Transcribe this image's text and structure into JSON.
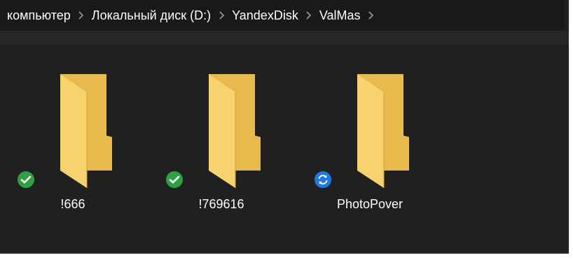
{
  "breadcrumb": {
    "items": [
      {
        "label": "компьютер"
      },
      {
        "label": "Локальный диск (D:)"
      },
      {
        "label": "YandexDisk"
      },
      {
        "label": "ValMas"
      }
    ]
  },
  "folders": [
    {
      "name": "!666",
      "status": "synced",
      "icon": "green-check-icon",
      "color": "#2ea043"
    },
    {
      "name": "!769616",
      "status": "synced",
      "icon": "green-check-icon",
      "color": "#2ea043"
    },
    {
      "name": "PhotoPover",
      "status": "syncing",
      "icon": "sync-arrows-icon",
      "color": "#1e78e6"
    }
  ],
  "colors": {
    "folder_front": "#f6d36e",
    "folder_back": "#e8b94c",
    "window_bg": "#202020"
  }
}
